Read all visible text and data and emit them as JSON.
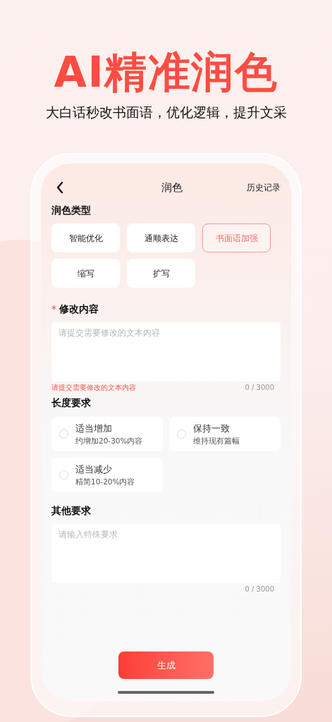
{
  "headline": "AI精准润色",
  "subtitle": "大白话秒改书面语，优化逻辑，提升文采",
  "nav": {
    "title": "润色",
    "action": "历史记录"
  },
  "polish_type": {
    "label": "润色类型",
    "options": [
      {
        "label": "智能优化",
        "selected": false
      },
      {
        "label": "通顺表达",
        "selected": false
      },
      {
        "label": "书面语加强",
        "selected": true
      },
      {
        "label": "缩写",
        "selected": false
      },
      {
        "label": "扩写",
        "selected": false
      }
    ]
  },
  "content": {
    "label": "修改内容",
    "required_mark": "*",
    "placeholder": "请提交需要修改的文本内容",
    "error": "请提交需要修改的文本内容",
    "counter": "0 / 3000"
  },
  "length": {
    "label": "长度要求",
    "options": [
      {
        "title": "适当增加",
        "description": "约增加20-30%内容",
        "selected": false
      },
      {
        "title": "保持一致",
        "description": "维持现有篇幅",
        "selected": false
      },
      {
        "title": "适当减少",
        "description": "精简10-20%内容",
        "selected": false
      }
    ]
  },
  "other": {
    "label": "其他要求",
    "placeholder": "请输入特殊要求",
    "counter": "0 / 3000"
  },
  "submit": "生成"
}
